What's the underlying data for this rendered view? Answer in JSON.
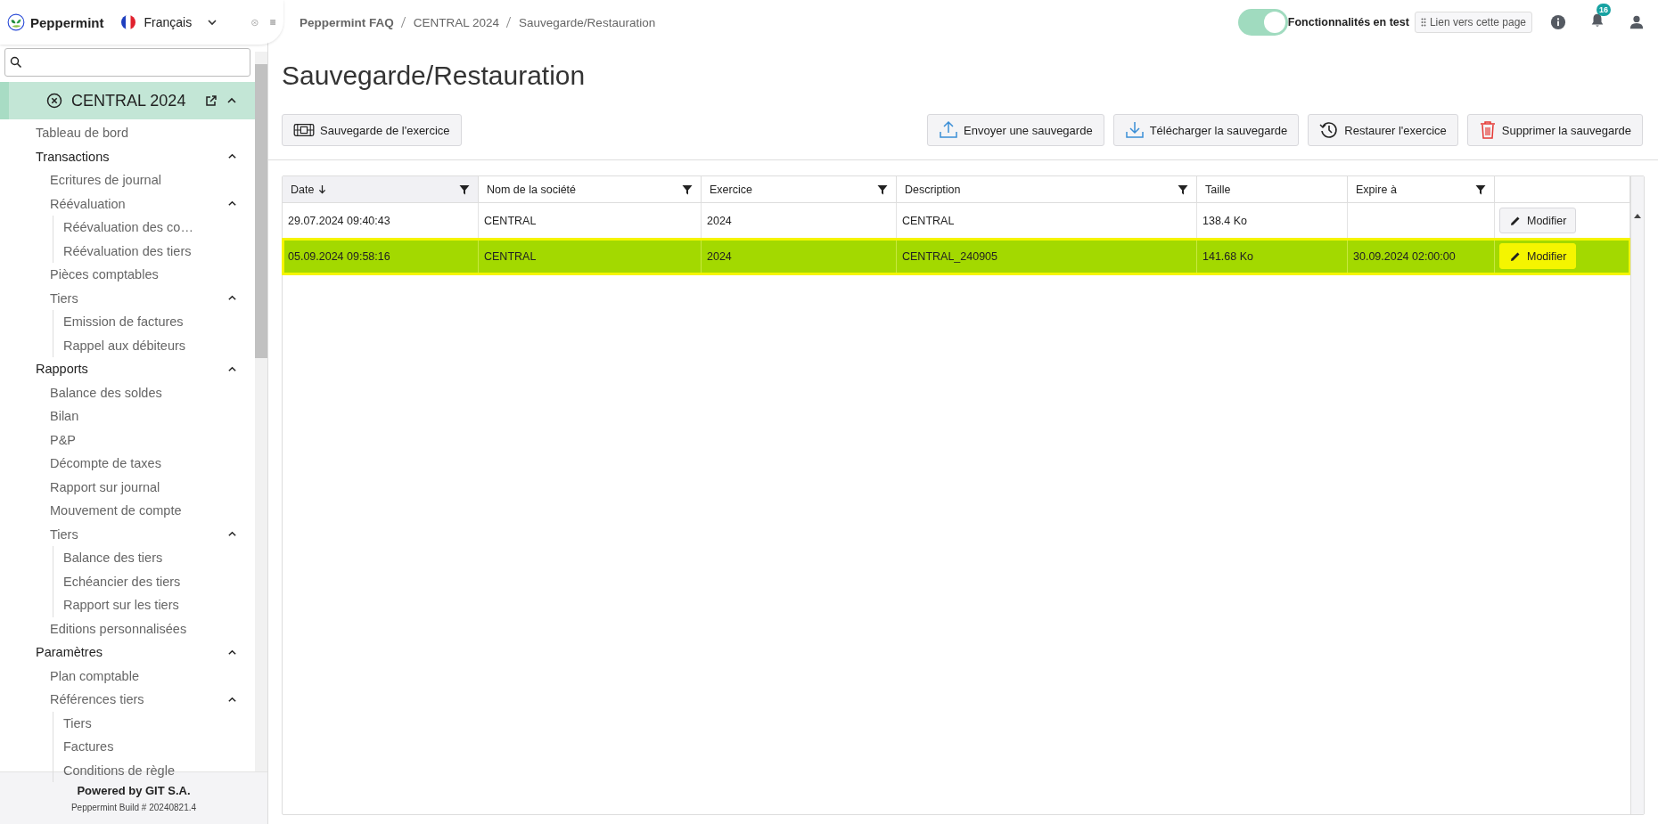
{
  "app": {
    "name": "Peppermint",
    "language": "Français"
  },
  "breadcrumb": [
    "Peppermint FAQ",
    "CENTRAL 2024",
    "Sauvegarde/Restauration"
  ],
  "test_toggle": {
    "label": "Fonctionnalités en test",
    "on": true
  },
  "link_button": "Lien vers cette page",
  "notification_count": "16",
  "sidebar": {
    "company": {
      "label": "CENTRAL 2024",
      "selected": true,
      "expanded": true
    },
    "items": [
      {
        "label": "Tableau de bord",
        "kind": "link"
      },
      {
        "label": "Transactions",
        "kind": "section",
        "expanded": true,
        "children": [
          {
            "label": "Ecritures de journal",
            "kind": "link"
          },
          {
            "label": "Réévaluation",
            "kind": "link",
            "expanded": true,
            "children": [
              {
                "label": "Réévaluation des co…",
                "kind": "link"
              },
              {
                "label": "Réévaluation des tiers",
                "kind": "link"
              }
            ]
          },
          {
            "label": "Pièces comptables",
            "kind": "link"
          },
          {
            "label": "Tiers",
            "kind": "link",
            "expanded": true,
            "children": [
              {
                "label": "Emission de factures",
                "kind": "link"
              },
              {
                "label": "Rappel aux débiteurs",
                "kind": "link"
              }
            ]
          }
        ]
      },
      {
        "label": "Rapports",
        "kind": "section",
        "expanded": true,
        "children": [
          {
            "label": "Balance des soldes",
            "kind": "link"
          },
          {
            "label": "Bilan",
            "kind": "link"
          },
          {
            "label": "P&P",
            "kind": "link"
          },
          {
            "label": "Décompte de taxes",
            "kind": "link"
          },
          {
            "label": "Rapport sur journal",
            "kind": "link"
          },
          {
            "label": "Mouvement de compte",
            "kind": "link"
          },
          {
            "label": "Tiers",
            "kind": "link",
            "expanded": true,
            "children": [
              {
                "label": "Balance des tiers",
                "kind": "link"
              },
              {
                "label": "Echéancier des tiers",
                "kind": "link"
              },
              {
                "label": "Rapport sur les tiers",
                "kind": "link"
              }
            ]
          },
          {
            "label": "Editions personnalisées",
            "kind": "link"
          }
        ]
      },
      {
        "label": "Paramètres",
        "kind": "section",
        "expanded": true,
        "children": [
          {
            "label": "Plan comptable",
            "kind": "link"
          },
          {
            "label": "Références tiers",
            "kind": "link",
            "expanded": true,
            "children": [
              {
                "label": "Tiers",
                "kind": "link"
              },
              {
                "label": "Factures",
                "kind": "link"
              },
              {
                "label": "Conditions de règle",
                "kind": "link"
              }
            ]
          }
        ]
      }
    ],
    "footer": {
      "powered": "Powered by GIT S.A.",
      "build": "Peppermint Build # 20240821.4"
    }
  },
  "page_title": "Sauvegarde/Restauration",
  "toolbar": {
    "left": [
      {
        "label": "Sauvegarde de l'exercice",
        "kind": "backup"
      }
    ],
    "right": [
      {
        "label": "Envoyer une sauvegarde",
        "kind": "upload"
      },
      {
        "label": "Télécharger la sauvegarde",
        "kind": "download"
      },
      {
        "label": "Restaurer l'exercice",
        "kind": "restore"
      },
      {
        "label": "Supprimer la sauvegarde",
        "kind": "delete"
      }
    ]
  },
  "table": {
    "columns": [
      {
        "label": "Date",
        "sorted": true,
        "filter": true
      },
      {
        "label": "Nom de la société",
        "sorted": false,
        "filter": true
      },
      {
        "label": "Exercice",
        "sorted": false,
        "filter": true
      },
      {
        "label": "Description",
        "sorted": false,
        "filter": true
      },
      {
        "label": "Taille",
        "sorted": false,
        "filter": false
      },
      {
        "label": "Expire à",
        "sorted": false,
        "filter": true
      }
    ],
    "rows": [
      {
        "cells": [
          "29.07.2024 09:40:43",
          "CENTRAL",
          "2024",
          "CENTRAL",
          "138.4 Ko",
          ""
        ],
        "action": "Modifier",
        "selected": false
      },
      {
        "cells": [
          "05.09.2024 09:58:16",
          "CENTRAL",
          "2024",
          "CENTRAL_240905",
          "141.68 Ko",
          "30.09.2024 02:00:00"
        ],
        "action": "Modifier",
        "selected": true
      }
    ]
  }
}
